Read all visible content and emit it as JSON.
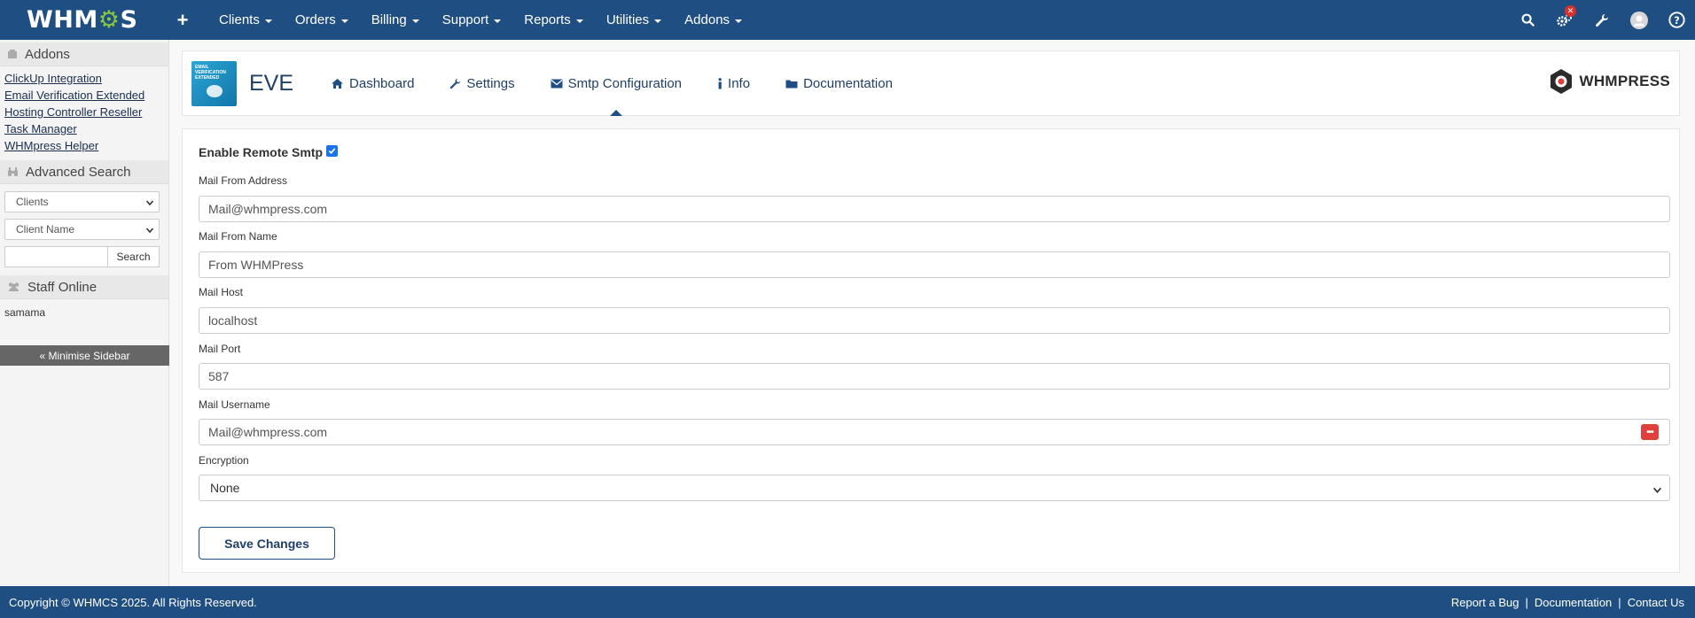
{
  "topbar": {
    "logo_text": "WHMCS",
    "nav": [
      {
        "label": "Clients"
      },
      {
        "label": "Orders"
      },
      {
        "label": "Billing"
      },
      {
        "label": "Support"
      },
      {
        "label": "Reports"
      },
      {
        "label": "Utilities"
      },
      {
        "label": "Addons"
      }
    ],
    "badge": "✕",
    "icons": [
      "search-icon",
      "gears-icon",
      "wrench-icon",
      "user-avatar",
      "help-icon"
    ]
  },
  "sidebar": {
    "addons_title": "Addons",
    "addons_links": [
      {
        "label": "ClickUp Integration"
      },
      {
        "label": "Email Verification Extended"
      },
      {
        "label": "Hosting Controller Reseller"
      },
      {
        "label": "Task Manager"
      },
      {
        "label": "WHMpress Helper"
      }
    ],
    "search_title": "Advanced Search",
    "search_type": "Clients",
    "search_field": "Client Name",
    "search_button": "Search",
    "staff_title": "Staff Online",
    "staff_name": "samama",
    "minimise": "« Minimise Sidebar"
  },
  "header": {
    "module_logo_text": "EMAIL VERIFICATION EXTENDED",
    "module_name": "EVE",
    "tabs": [
      {
        "label": "Dashboard",
        "icon": "home-icon"
      },
      {
        "label": "Settings",
        "icon": "wrench-icon"
      },
      {
        "label": "Smtp Configuration",
        "icon": "envelope-icon"
      },
      {
        "label": "Info",
        "icon": "info-icon"
      },
      {
        "label": "Documentation",
        "icon": "folder-icon"
      }
    ],
    "brand": "WHMPRESS"
  },
  "form": {
    "enable_label": "Enable Remote Smtp",
    "enable_checked": true,
    "fields": [
      {
        "label": "Mail From Address",
        "value": "Mail@whmpress.com"
      },
      {
        "label": "Mail From Name",
        "value": "From WHMPress"
      },
      {
        "label": "Mail Host",
        "value": "localhost"
      },
      {
        "label": "Mail Port",
        "value": "587"
      },
      {
        "label": "Mail Username",
        "value": "Mail@whmpress.com"
      }
    ],
    "encryption_label": "Encryption",
    "encryption_value": "None",
    "save_label": "Save Changes"
  },
  "footer": {
    "copyright": "Copyright © WHMCS 2025. All Rights Reserved.",
    "links": [
      {
        "label": "Report a Bug"
      },
      {
        "label": "Documentation"
      },
      {
        "label": "Contact Us"
      }
    ]
  },
  "colors": {
    "primary": "#1f4f82",
    "accent_green": "#8cc63f",
    "danger": "#d9302b"
  }
}
